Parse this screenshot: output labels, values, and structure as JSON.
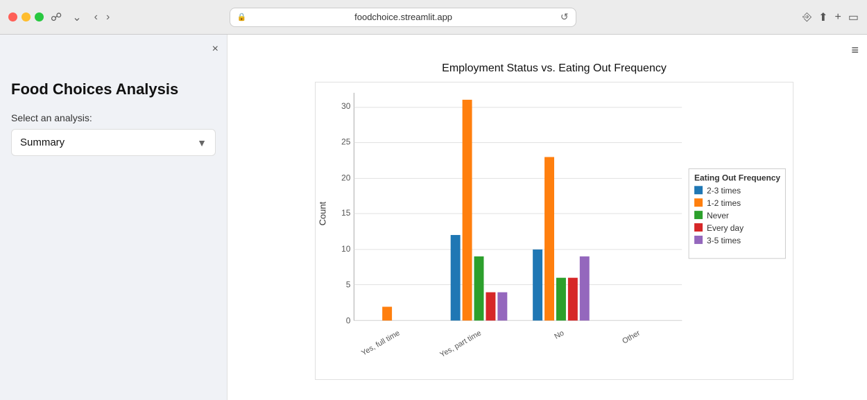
{
  "browser": {
    "url": "foodchoice.streamlit.app",
    "reload_icon": "↺"
  },
  "sidebar": {
    "title": "Food Choices Analysis",
    "select_label": "Select an analysis:",
    "selected_value": "Summary",
    "close_icon": "×"
  },
  "main": {
    "hamburger_icon": "≡",
    "chart": {
      "title": "Employment Status vs. Eating Out Frequency",
      "y_axis_label": "Count",
      "x_labels": [
        "Yes, full time",
        "Yes, part time",
        "No",
        "Other"
      ],
      "legend_title": "Eating Out Frequency",
      "legend_items": [
        {
          "label": "2-3 times",
          "color": "#1f77b4"
        },
        {
          "label": "1-2 times",
          "color": "#ff7f0e"
        },
        {
          "label": "Never",
          "color": "#2ca02c"
        },
        {
          "label": "Every day",
          "color": "#d62728"
        },
        {
          "label": "3-5 times",
          "color": "#9467bd"
        }
      ],
      "y_ticks": [
        0,
        5,
        10,
        15,
        20,
        25,
        30
      ],
      "data": {
        "yes_full_time": {
          "two_three": 0,
          "one_two": 2,
          "never": 0,
          "every_day": 0,
          "three_five": 0
        },
        "yes_part_time": {
          "two_three": 12,
          "one_two": 31,
          "never": 9,
          "every_day": 4,
          "three_five": 4
        },
        "no": {
          "two_three": 10,
          "one_two": 23,
          "never": 6,
          "every_day": 6,
          "three_five": 9
        },
        "other": {
          "two_three": 0,
          "one_two": 0,
          "never": 0,
          "every_day": 0,
          "three_five": 0
        }
      }
    }
  }
}
